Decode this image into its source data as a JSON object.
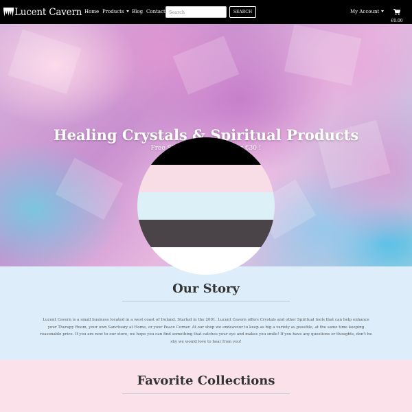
{
  "navbar": {
    "brand": {
      "name": "Lucent Cavern",
      "logo_icon": "crystal-cave-logo"
    },
    "links": [
      {
        "label": "Home"
      },
      {
        "label": "Products",
        "dropdown": true
      },
      {
        "label": "Blog"
      },
      {
        "label": "Contact"
      }
    ],
    "search": {
      "placeholder": "Search",
      "button_label": "SEARCH"
    },
    "account": {
      "label": "My Account",
      "dropdown": true
    },
    "cart": {
      "icon": "cart-icon",
      "total": "€0.00"
    }
  },
  "hero": {
    "title": "Healing Crystals & Spiritual Products",
    "subtitle": "Free Shipping on orders over €30 !"
  },
  "flag": {
    "stripes": [
      "#000000",
      "#f8dce6",
      "#dcf0f8",
      "#4a4448",
      "#ffffff"
    ]
  },
  "story": {
    "title": "Our Story",
    "text": "Lucent Cavern is a small business located in a west coast of Ireland. Started in the 2001. Lucent Cavern offers Crystals and other Spiritual tools that can help enhance your Therapy Room, your own Sanctuary at Home, or your Peace Corner. At our shop we endeavour to keep as big a variety as possible, at the same time keeping reasonable price. If you are new to our store, we hope you can find something that catches your eye and makes you smile! If you have any questions or thoughts, don't be shy we would love to hear from you!"
  },
  "collections": {
    "title": "Favorite Collections"
  },
  "colors": {
    "navbar_bg": "#000000",
    "story_bg": "#ddeefa",
    "collections_bg": "#fae1ea"
  }
}
